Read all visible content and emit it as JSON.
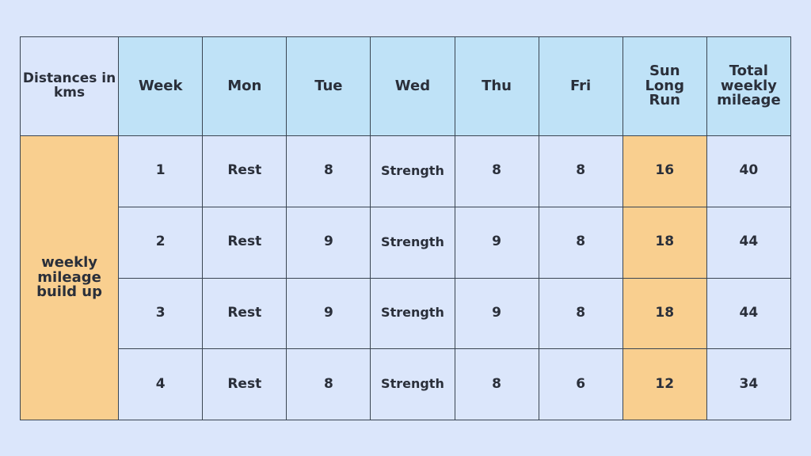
{
  "table": {
    "corner_label": "Distances in kms",
    "row_group_label": "weekly mileage build up",
    "headers": [
      "Week",
      "Mon",
      "Tue",
      "Wed",
      "Thu",
      "Fri",
      "Sun Long Run",
      "Total weekly mileage"
    ],
    "rows": [
      {
        "week": "1",
        "mon": "Rest",
        "tue": "8",
        "wed": "Strength",
        "thu": "8",
        "fri": "8",
        "sun": "16",
        "total": "40"
      },
      {
        "week": "2",
        "mon": "Rest",
        "tue": "9",
        "wed": "Strength",
        "thu": "9",
        "fri": "8",
        "sun": "18",
        "total": "44"
      },
      {
        "week": "3",
        "mon": "Rest",
        "tue": "9",
        "wed": "Strength",
        "thu": "9",
        "fri": "8",
        "sun": "18",
        "total": "44"
      },
      {
        "week": "4",
        "mon": "Rest",
        "tue": "8",
        "wed": "Strength",
        "thu": "8",
        "fri": "6",
        "sun": "12",
        "total": "34"
      }
    ]
  },
  "colors": {
    "background": "#dbe6fb",
    "header": "#bfe2f7",
    "accent": "#f9cf8f",
    "border": "#3a4552",
    "text": "#2a2f3a"
  }
}
